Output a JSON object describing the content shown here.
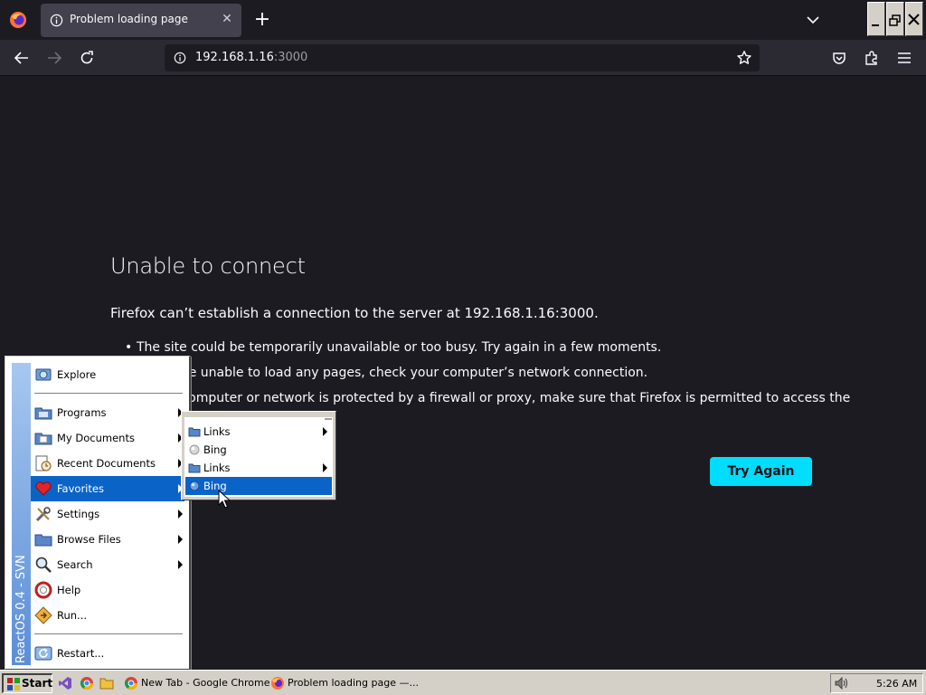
{
  "browser": {
    "tab": {
      "title": "Problem loading page",
      "close": "✕"
    },
    "new_tab": "+",
    "url": {
      "host": "192.168.1.16",
      "port": ":3000"
    }
  },
  "error_page": {
    "title": "Unable to connect",
    "description": "Firefox can’t establish a connection to the server at 192.168.1.16:3000.",
    "bullets": [
      "The site could be temporarily unavailable or too busy. Try again in a few moments.",
      "If you are unable to load any pages, check your computer’s network connection.",
      "If your computer or network is protected by a firewall or proxy, make sure that Firefox is permitted to access the"
    ],
    "try_again_label": "Try Again",
    "accent_color": "#00ddff"
  },
  "start_menu": {
    "banner_text": "ReactOS 0.4 - SVN",
    "items": [
      {
        "label": "Explore",
        "icon": "explore-icon"
      },
      {
        "label": "Programs",
        "icon": "programs-folder-icon"
      },
      {
        "label": "My Documents",
        "icon": "documents-folder-icon"
      },
      {
        "label": "Recent Documents",
        "icon": "recent-documents-icon"
      },
      {
        "label": "Favorites",
        "icon": "heart-icon"
      },
      {
        "label": "Settings",
        "icon": "settings-icon"
      },
      {
        "label": "Browse Files",
        "icon": "folder-icon"
      },
      {
        "label": "Search",
        "icon": "magnifier-icon"
      },
      {
        "label": "Help",
        "icon": "lifebuoy-icon"
      },
      {
        "label": "Run...",
        "icon": "run-icon"
      },
      {
        "label": "Restart...",
        "icon": "restart-icon"
      }
    ],
    "selected": "Favorites",
    "selection_color": "#0a64c8"
  },
  "favorites_submenu": {
    "items": [
      {
        "label": "Links",
        "icon": "folder-icon",
        "has_submenu": true
      },
      {
        "label": "Bing",
        "icon": "globe-icon",
        "has_submenu": false
      },
      {
        "label": "Links",
        "icon": "folder-icon",
        "has_submenu": true
      },
      {
        "label": "Bing",
        "icon": "globe-icon",
        "has_submenu": false
      }
    ],
    "selected_index": 3
  },
  "taskbar": {
    "start_label": "Start",
    "tasks": [
      {
        "label": "New Tab - Google Chrome",
        "icon": "chrome-icon"
      },
      {
        "label": "Problem loading page —...",
        "icon": "firefox-icon"
      }
    ],
    "clock": "5:26 AM"
  }
}
